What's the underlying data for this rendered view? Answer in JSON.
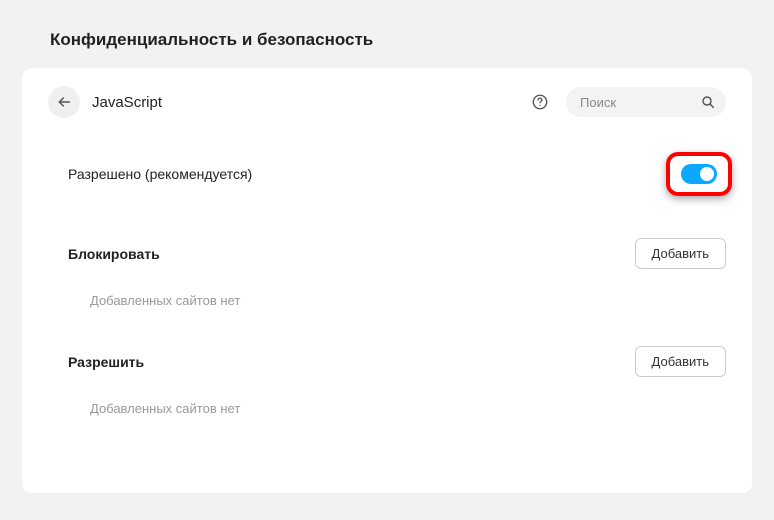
{
  "section_title": "Конфиденциальность и безопасность",
  "header": {
    "page_name": "JavaScript",
    "search_placeholder": "Поиск"
  },
  "allowed_row": {
    "label": "Разрешено (рекомендуется)",
    "enabled": true
  },
  "block_section": {
    "title": "Блокировать",
    "add_label": "Добавить",
    "empty_text": "Добавленных сайтов нет"
  },
  "allow_section": {
    "title": "Разрешить",
    "add_label": "Добавить",
    "empty_text": "Добавленных сайтов нет"
  }
}
